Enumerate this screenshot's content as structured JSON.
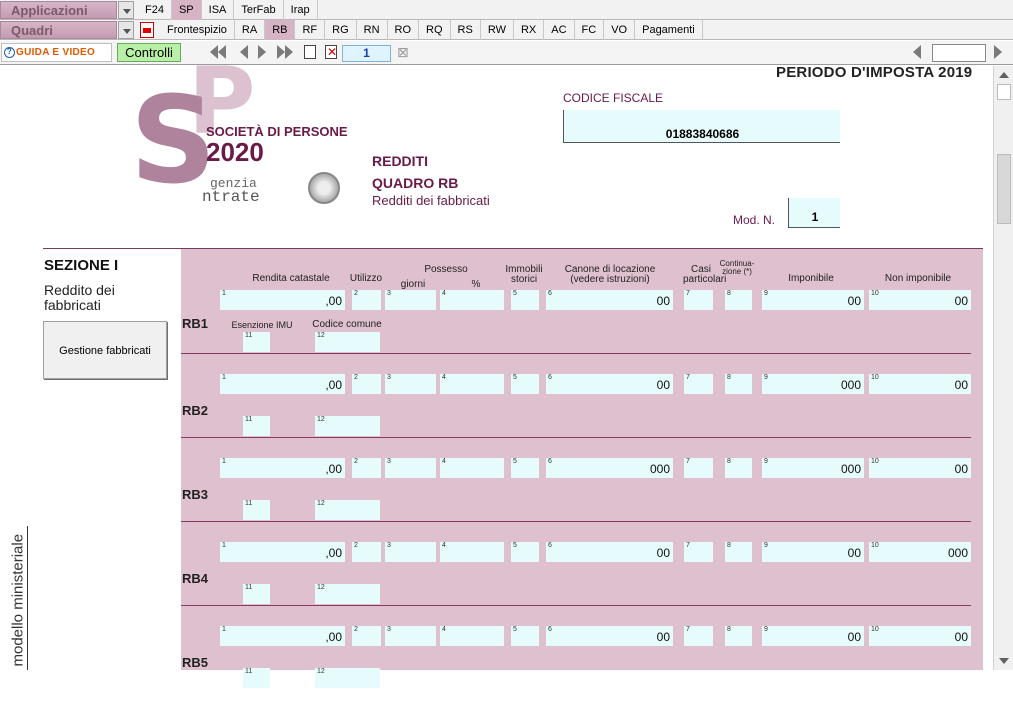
{
  "menu": {
    "applicazioni": "Applicazioni",
    "quadri": "Quadri",
    "row1_tabs": [
      "F24",
      "SP",
      "ISA",
      "TerFab",
      "Irap"
    ],
    "row1_active": 1,
    "row2_tabs": [
      "Frontespizio",
      "RA",
      "RB",
      "RF",
      "RG",
      "RN",
      "RO",
      "RQ",
      "RS",
      "RW",
      "RX",
      "AC",
      "FC",
      "VO",
      "Pagamenti"
    ],
    "row2_active": 2
  },
  "toolbar": {
    "guida_label": "GUIDA E VIDEO",
    "controlli_label": "Controlli",
    "page_number": "1"
  },
  "header": {
    "periodo": "PERIODO D'IMPOSTA 2019",
    "societa": "SOCIETÀ DI PERSONE",
    "anno": "2020",
    "agenzia": "genzia",
    "entrate": "ntrate",
    "redditi": "REDDITI",
    "quadro": "QUADRO RB",
    "subtitle": "Redditi dei fabbricati",
    "cf_label": "CODICE FISCALE",
    "cf_value": "01883840686",
    "modn_label": "Mod. N.",
    "modn_value": "1"
  },
  "section": {
    "title": "SEZIONE I",
    "subtitle": "Reddito dei fabbricati",
    "button_label": "Gestione fabbricati",
    "vertical_text": "modello ministeriale"
  },
  "columns": {
    "rendita": "Rendita catastale",
    "utilizzo": "Utilizzo",
    "possesso": "Possesso",
    "giorni": "giorni",
    "perc": "%",
    "immobili": "Immobili storici",
    "canone": "Canone di locazione (vedere istruzioni)",
    "casi": "Casi particolari",
    "continuazione": "Continua-zione (*)",
    "imponibile": "Imponibile",
    "non_imponibile": "Non imponibile",
    "esenzione": "Esenzione IMU",
    "codice_comune": "Codice comune"
  },
  "rows": [
    {
      "label": "RB1",
      "f1": ",00",
      "f6": "00",
      "f9": "00",
      "f10": "00"
    },
    {
      "label": "RB2",
      "f1": ",00",
      "f6": "00",
      "f9": "000",
      "f10": "00"
    },
    {
      "label": "RB3",
      "f1": ",00",
      "f6": "000",
      "f9": "000",
      "f10": "00"
    },
    {
      "label": "RB4",
      "f1": ",00",
      "f6": "00",
      "f9": "00",
      "f10": "000"
    },
    {
      "label": "RB5",
      "f1": ",00",
      "f6": "00",
      "f9": "00",
      "f10": "00"
    }
  ]
}
